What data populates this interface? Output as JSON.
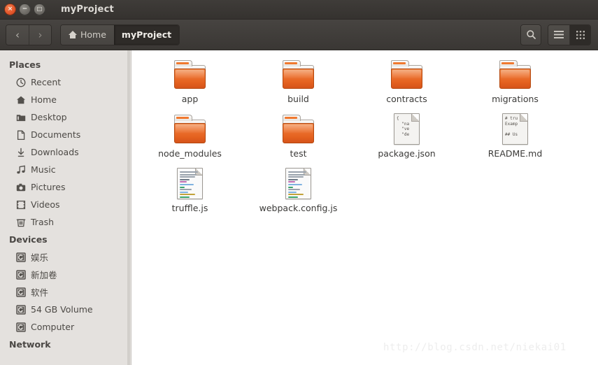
{
  "window": {
    "title": "myProject",
    "controls": [
      {
        "name": "close",
        "glyph": "×"
      },
      {
        "name": "minimize",
        "glyph": "−"
      },
      {
        "name": "maximize",
        "glyph": "□"
      }
    ]
  },
  "toolbar": {
    "back_label": "‹",
    "forward_label": "›",
    "breadcrumbs": [
      {
        "label": "Home",
        "icon": "home-icon",
        "active": false
      },
      {
        "label": "myProject",
        "icon": "",
        "active": true
      }
    ],
    "search_icon": "search-icon",
    "list_view_icon": "list-view-icon",
    "grid_view_icon": "grid-view-icon"
  },
  "sidebar": {
    "groups": [
      {
        "title": "Places",
        "items": [
          {
            "label": "Recent",
            "icon": "clock-icon"
          },
          {
            "label": "Home",
            "icon": "home-icon"
          },
          {
            "label": "Desktop",
            "icon": "desktop-folder-icon"
          },
          {
            "label": "Documents",
            "icon": "document-icon"
          },
          {
            "label": "Downloads",
            "icon": "download-icon"
          },
          {
            "label": "Music",
            "icon": "music-note-icon"
          },
          {
            "label": "Pictures",
            "icon": "camera-icon"
          },
          {
            "label": "Videos",
            "icon": "film-icon"
          },
          {
            "label": "Trash",
            "icon": "trash-icon"
          }
        ]
      },
      {
        "title": "Devices",
        "items": [
          {
            "label": "娱乐",
            "icon": "harddisk-icon"
          },
          {
            "label": "新加卷",
            "icon": "harddisk-icon"
          },
          {
            "label": "软件",
            "icon": "harddisk-icon"
          },
          {
            "label": "54 GB Volume",
            "icon": "harddisk-icon"
          },
          {
            "label": "Computer",
            "icon": "harddisk-icon"
          }
        ]
      },
      {
        "title": "Network",
        "items": []
      }
    ]
  },
  "files": [
    {
      "name": "app",
      "type": "folder"
    },
    {
      "name": "build",
      "type": "folder"
    },
    {
      "name": "contracts",
      "type": "folder"
    },
    {
      "name": "migrations",
      "type": "folder"
    },
    {
      "name": "node_modules",
      "type": "folder"
    },
    {
      "name": "test",
      "type": "folder"
    },
    {
      "name": "package.json",
      "type": "document",
      "preview": "{\n  \"na\n  \"ve\n  \"de"
    },
    {
      "name": "README.md",
      "type": "document",
      "preview": "# tru\nExamp\n\n## Us"
    },
    {
      "name": "truffle.js",
      "type": "code"
    },
    {
      "name": "webpack.config.js",
      "type": "code"
    }
  ],
  "watermark": "http://blog.csdn.net/niekai01",
  "colors": {
    "accent_orange": "#ef6a3d",
    "folder_orange": "#e4611f",
    "titlebar": "#3a3734",
    "toolbar": "#403d3a",
    "sidebar_bg": "#e4e1de",
    "file_bg": "#ffffff"
  }
}
